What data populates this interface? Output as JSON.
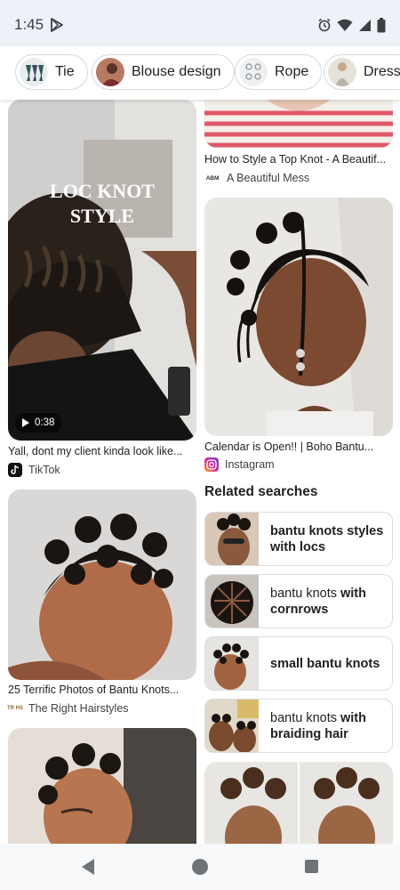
{
  "status_bar": {
    "time": "1:45",
    "icons": [
      "play-store-icon",
      "alarm-icon",
      "wifi-icon",
      "signal-icon",
      "battery-icon"
    ]
  },
  "chips": [
    {
      "label": "Tie",
      "icon": "tie-thumb"
    },
    {
      "label": "Blouse design",
      "icon": "blouse-thumb"
    },
    {
      "label": "Rope",
      "icon": "rope-thumb"
    },
    {
      "label": "Dress",
      "icon": "dress-thumb"
    }
  ],
  "left_column": [
    {
      "image_text": [
        "LOC KNOT",
        "STYLE"
      ],
      "video_duration": "0:38",
      "title": "Yall, dont my client kinda look like...",
      "source": "TikTok",
      "source_icon": "tiktok-icon"
    },
    {
      "title": "25 Terrific Photos of Bantu Knots...",
      "source": "The Right Hairstyles",
      "source_icon": "the-right-hairstyles-icon",
      "source_icon_text": "TR HS"
    },
    {
      "title": "",
      "source": ""
    }
  ],
  "right_column": [
    {
      "title": "How to Style a Top Knot - A Beautif...",
      "source": "A Beautiful Mess",
      "source_icon": "a-beautiful-mess-icon",
      "source_icon_text": "ABM"
    },
    {
      "title": "Calendar is Open!! | Boho Bantu...",
      "source": "Instagram",
      "source_icon": "instagram-icon"
    }
  ],
  "related_searches": {
    "heading": "Related searches",
    "items": [
      {
        "prefix": "bantu knots styles with locs",
        "bold_all": true,
        "rest": ""
      },
      {
        "prefix": "bantu knots ",
        "rest": "with cornrows",
        "bold_all": false
      },
      {
        "prefix": "small bantu knots",
        "bold_all": true,
        "rest": ""
      },
      {
        "prefix": "bantu knots ",
        "rest": "with braiding hair",
        "bold_all": false
      }
    ]
  },
  "colors": {
    "status_bg": "#eef1f8",
    "chip_border": "#d5d8dc",
    "text_primary": "#202124",
    "nav_icon": "#6f7378"
  },
  "nav_bar": {
    "buttons": [
      "back-button",
      "home-button",
      "recents-button"
    ]
  }
}
